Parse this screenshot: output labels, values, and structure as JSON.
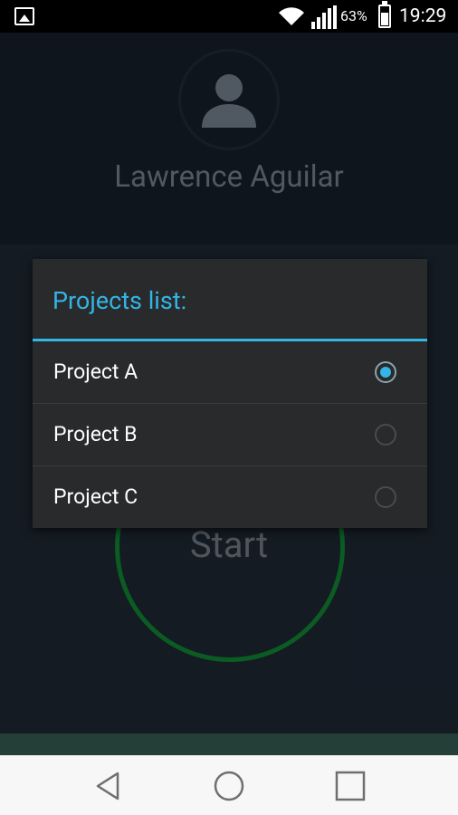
{
  "status_bar": {
    "battery_percent": "63%",
    "time": "19:29",
    "icons": [
      "gallery-icon",
      "wifi-icon",
      "signal-icon",
      "battery-icon"
    ]
  },
  "profile": {
    "user_name": "Lawrence Aguilar",
    "avatar_icon": "person-icon"
  },
  "dialog": {
    "title": "Projects list:",
    "options": [
      {
        "label": "Project A",
        "selected": true
      },
      {
        "label": "Project B",
        "selected": false
      },
      {
        "label": "Project C",
        "selected": false
      }
    ]
  },
  "main": {
    "start_label": "Start"
  },
  "colors": {
    "accent": "#33b5e5",
    "ring": "#0e6b2a"
  },
  "nav": {
    "icons": [
      "back-icon",
      "home-icon",
      "recents-icon"
    ]
  }
}
